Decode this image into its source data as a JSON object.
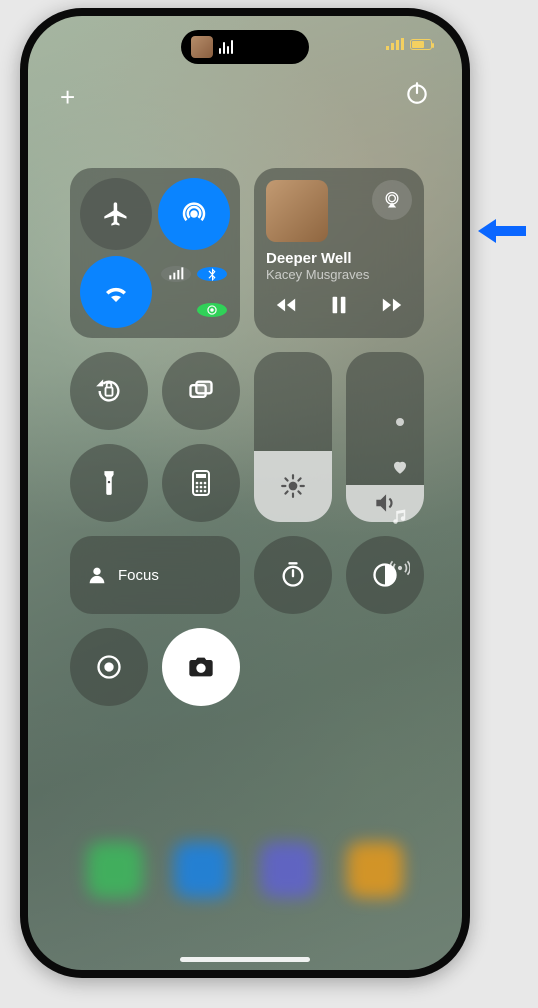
{
  "status": {
    "signal": "􀙇"
  },
  "topbar": {
    "add": "+",
    "power": "power-icon"
  },
  "connectivity": {
    "airplane": {
      "icon": "airplane",
      "active": false
    },
    "airdrop": {
      "icon": "airdrop",
      "active": true
    },
    "wifi": {
      "icon": "wifi",
      "active": true
    },
    "more": {
      "cellular": {
        "active": false
      },
      "bluetooth": {
        "active": true
      },
      "hotspot": {
        "active": true,
        "color": "green"
      }
    }
  },
  "media": {
    "title": "Deeper Well",
    "artist": "Kacey Musgraves",
    "playing": false,
    "controls": {
      "prev": "⏮",
      "playpause": "⏸",
      "next": "⏭"
    },
    "airplay": "airplay-icon"
  },
  "controls": {
    "orientation_lock": "rotation-lock",
    "screen_mirroring": "rectangles",
    "flashlight": "flashlight",
    "calculator": "calculator",
    "timer": "timer",
    "dark_mode": "contrast",
    "screen_record": "record",
    "camera": "camera"
  },
  "focus": {
    "label": "Focus",
    "icon": "person"
  },
  "sliders": {
    "brightness": {
      "value_pct": 42,
      "icon": "sun"
    },
    "volume": {
      "value_pct": 22,
      "icon": "speaker"
    }
  },
  "side_nav": {
    "favorite": "heart",
    "music": "music-note",
    "nearby": "broadcast"
  },
  "annotation": {
    "arrow_points_to": "media-module"
  }
}
